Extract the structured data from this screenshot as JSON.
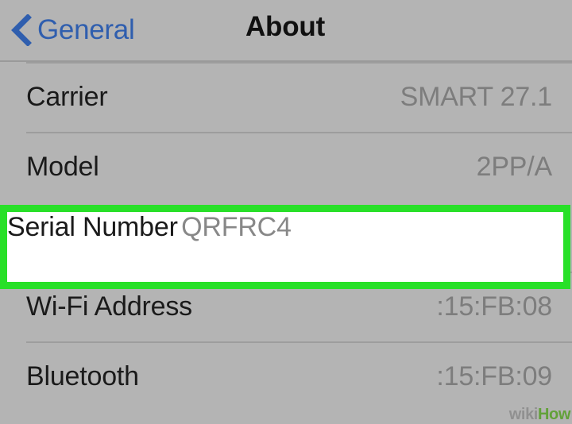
{
  "navbar": {
    "back_label": "General",
    "back_icon": "chevron-left-icon",
    "title": "About",
    "back_color": "#2f5eae",
    "title_color": "#101010"
  },
  "list": {
    "rows": [
      {
        "label": "Carrier",
        "value": "SMART 27.1",
        "highlighted": false
      },
      {
        "label": "Model",
        "value": "2PP/A",
        "highlighted": false
      },
      {
        "label": "Serial Number",
        "value": "QRFRC4",
        "highlighted": true
      },
      {
        "label": "Wi-Fi Address",
        "value": ":15:FB:08",
        "highlighted": false
      },
      {
        "label": "Bluetooth",
        "value": ":15:FB:09",
        "highlighted": false
      }
    ]
  },
  "highlight": {
    "color": "#28e028",
    "background": "#ffffff"
  },
  "theme": {
    "background": "#b4b4b4",
    "label_color": "#1a1a1a",
    "value_color": "#7d7d7d",
    "separator_color": "#9d9d9d"
  },
  "watermark": {
    "part1": "wiki",
    "part2": "How"
  }
}
